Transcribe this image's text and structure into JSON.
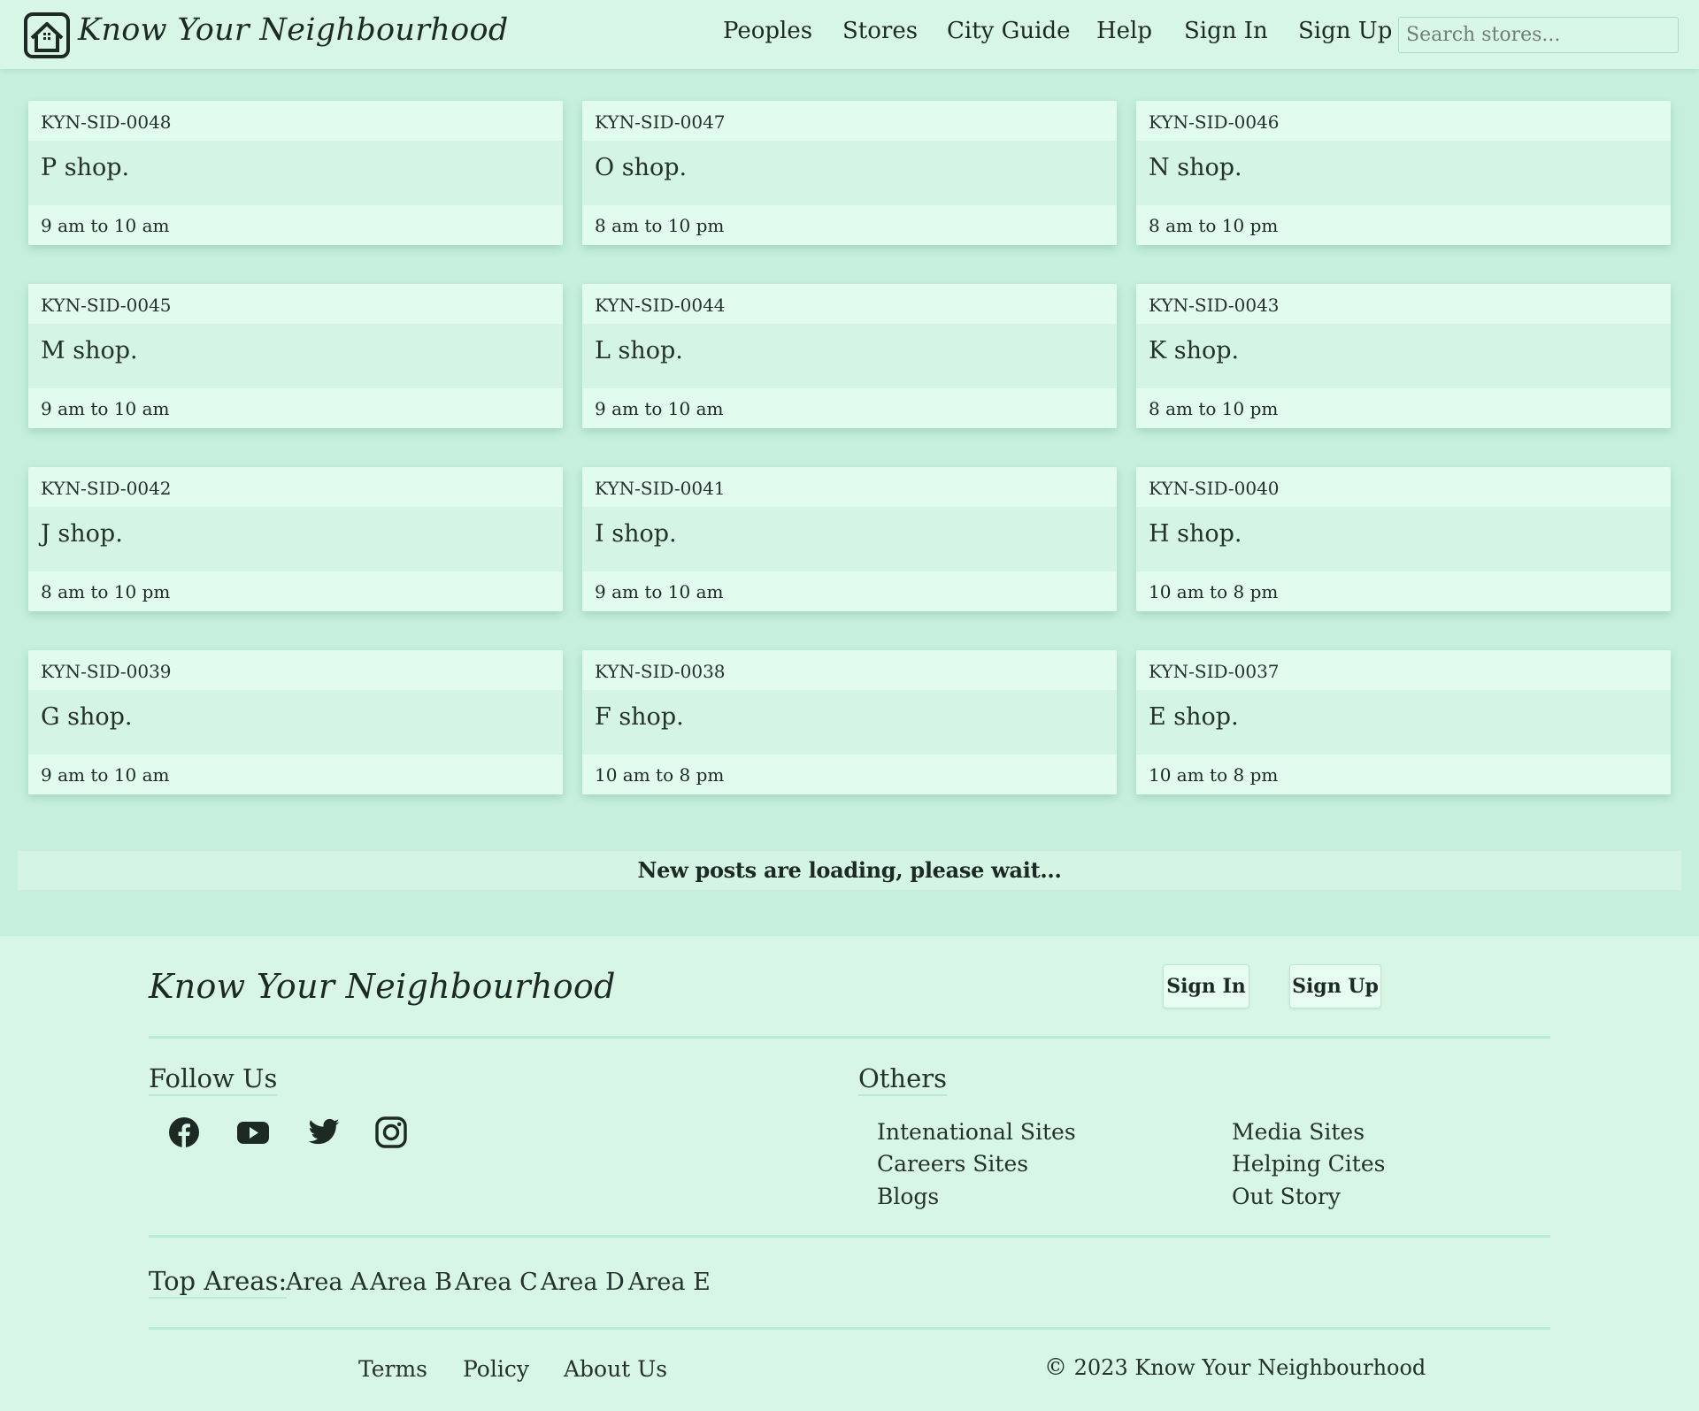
{
  "header": {
    "brand": "Know Your Neighbourhood",
    "nav": [
      "Peoples",
      "Stores",
      "City Guide",
      "Help",
      "Sign In",
      "Sign Up"
    ],
    "search_placeholder": "Search stores..."
  },
  "stores": [
    {
      "id": "KYN-SID-0048",
      "name": "P shop.",
      "hours": "9 am to 10 am"
    },
    {
      "id": "KYN-SID-0047",
      "name": "O shop.",
      "hours": "8 am to 10 pm"
    },
    {
      "id": "KYN-SID-0046",
      "name": "N shop.",
      "hours": "8 am to 10 pm"
    },
    {
      "id": "KYN-SID-0045",
      "name": "M shop.",
      "hours": "9 am to 10 am"
    },
    {
      "id": "KYN-SID-0044",
      "name": "L shop.",
      "hours": "9 am to 10 am"
    },
    {
      "id": "KYN-SID-0043",
      "name": "K shop.",
      "hours": "8 am to 10 pm"
    },
    {
      "id": "KYN-SID-0042",
      "name": "J shop.",
      "hours": "8 am to 10 pm"
    },
    {
      "id": "KYN-SID-0041",
      "name": "I shop.",
      "hours": "9 am to 10 am"
    },
    {
      "id": "KYN-SID-0040",
      "name": "H shop.",
      "hours": "10 am to 8 pm"
    },
    {
      "id": "KYN-SID-0039",
      "name": "G shop.",
      "hours": "9 am to 10 am"
    },
    {
      "id": "KYN-SID-0038",
      "name": "F shop.",
      "hours": "10 am to 8 pm"
    },
    {
      "id": "KYN-SID-0037",
      "name": "E shop.",
      "hours": "10 am to 8 pm"
    }
  ],
  "loading_text": "New posts are loading, please wait...",
  "footer": {
    "brand": "Know Your Neighbourhood",
    "sign_in": "Sign In",
    "sign_up": "Sign Up",
    "follow_heading": "Follow Us",
    "social_icons": [
      "facebook-icon",
      "youtube-icon",
      "twitter-icon",
      "instagram-icon"
    ],
    "others_heading": "Others",
    "others_links": [
      "Intenational Sites",
      "Careers Sites",
      "Blogs",
      "Media Sites",
      "Helping Cites",
      "Out Story"
    ],
    "top_areas_label": "Top Areas:",
    "areas": [
      "Area A",
      "Area B",
      "Area C",
      "Area D",
      "Area E"
    ],
    "bottom_links": [
      "Terms",
      "Policy",
      "About Us"
    ],
    "copyright_symbol": "©",
    "copyright": "2023 Know Your Neighbourhood"
  }
}
